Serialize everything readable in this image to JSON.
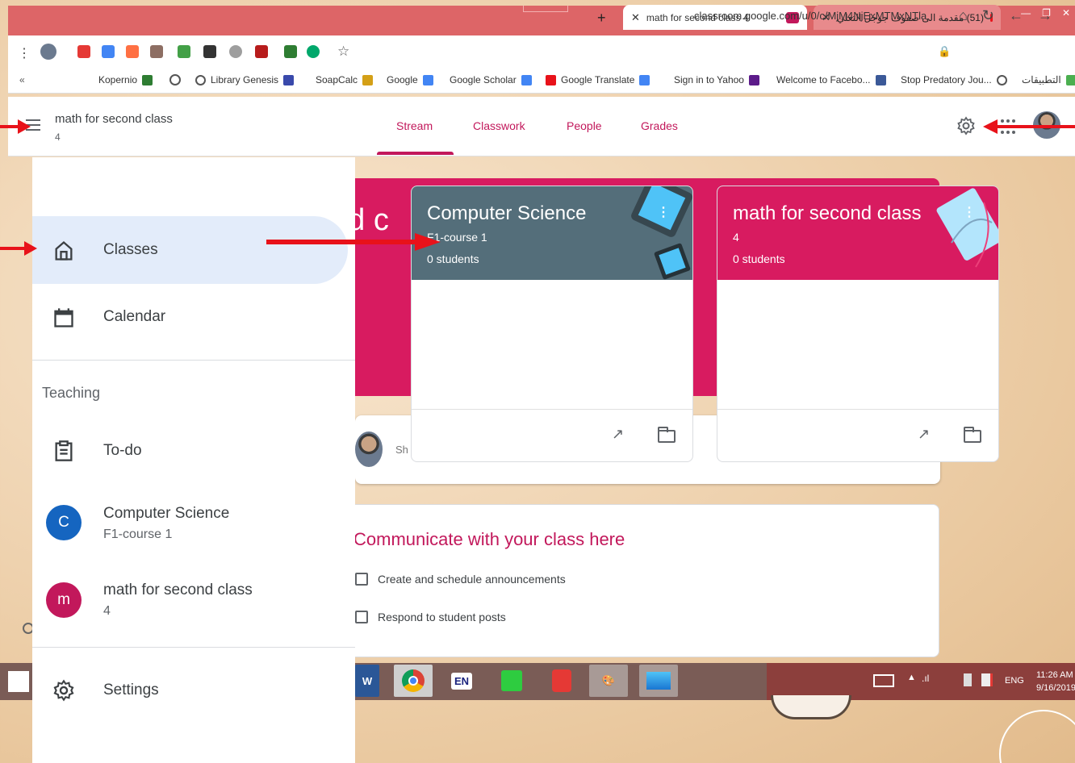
{
  "browser": {
    "tabs": [
      {
        "title": "math for second class 4",
        "active": true
      },
      {
        "title": "(51) مقدمة الى صفوف جوجل التعلي",
        "active": false
      }
    ],
    "url": "classroom.google.com/u/0/c/MjM4NjExMTMxNTla",
    "bookmarks": [
      "Kopernio",
      "Library Genesis",
      "SoapCalc",
      "Google",
      "Google Scholar",
      "Google Translate",
      "Sign in to Yahoo",
      "Welcome to Facebo...",
      "Stop Predatory Jou...",
      "التطبيقات"
    ],
    "overflow": "«"
  },
  "header": {
    "class_title": "math for second class",
    "class_section": "4",
    "tabs": [
      "Stream",
      "Classwork",
      "People",
      "Grades"
    ],
    "active_tab": "Stream"
  },
  "stream": {
    "banner_text": "nd c",
    "post_hint": "Sh",
    "communicate_title": "Communicate with your class here",
    "items": [
      "Create and schedule announcements",
      "Respond to student posts"
    ]
  },
  "cards": [
    {
      "title": "Computer Science",
      "section": "F1-course 1",
      "students": "0 students",
      "color": "#546e7a"
    },
    {
      "title": "math for second class",
      "section": "4",
      "students": "0 students",
      "color": "#d81b60"
    }
  ],
  "drawer": {
    "classes": "Classes",
    "calendar": "Calendar",
    "teaching": "Teaching",
    "todo": "To-do",
    "class1": {
      "initial": "C",
      "name": "Computer Science",
      "section": "F1-course 1",
      "color": "#1565c0"
    },
    "class2": {
      "initial": "m",
      "name": "math for second class",
      "section": "4",
      "color": "#c2185b"
    },
    "settings": "Settings"
  },
  "taskbar": {
    "time": "11:26 AM",
    "date": "9/16/2019",
    "lang": "ENG",
    "apps": [
      "W",
      "Chrome",
      "EN",
      "Screen",
      "Recorder",
      "Paint",
      "Photos"
    ]
  },
  "colors": {
    "accent": "#c2185b",
    "annotation_arrow": "#e8121a",
    "drawer_selected": "#e3ecfa"
  }
}
